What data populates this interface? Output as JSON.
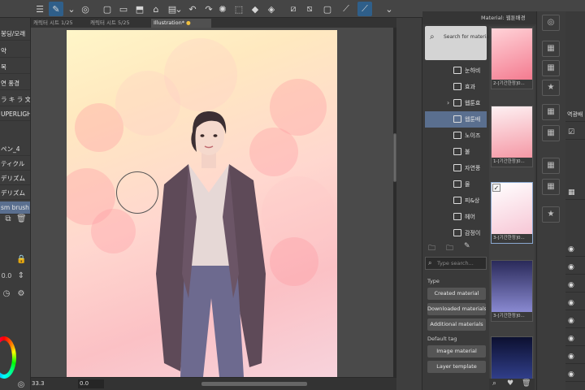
{
  "toolbar": {
    "icons": [
      "menu-icon",
      "pen-tool-icon",
      "chevron-down-icon",
      "layer-settings-icon",
      "clear-icon",
      "new-icon",
      "open-icon",
      "save-icon",
      "print-icon",
      "chevron-down-icon",
      "undo-icon",
      "redo-icon",
      "loading-icon",
      "transform-icon",
      "fill-icon",
      "eraser-icon",
      "selection-icon",
      "snap-icon",
      "ruler-icon",
      "chevron-down-icon"
    ]
  },
  "left_panel": {
    "brushes": [
      {
        "label": "봉딩/모래"
      },
      {
        "label": "약"
      },
      {
        "label": "목"
      },
      {
        "label": "연 풍경"
      },
      {
        "label": "ラ キ ラ 文"
      },
      {
        "label": "UPERLIGH"
      },
      {
        "label": "ペン_4"
      },
      {
        "label": "ティクル"
      },
      {
        "label": "デリズム"
      },
      {
        "label": "デリズム"
      },
      {
        "label": "sm brush"
      }
    ],
    "selected_index": 10,
    "brush_size": "0.0"
  },
  "tabs": [
    {
      "label": "캐릭터 시트",
      "count": "1/25"
    },
    {
      "label": "캐릭터 시트",
      "count": "5/25"
    },
    {
      "label": "Illustration*"
    }
  ],
  "status": {
    "zoom": "33.3",
    "angle": "0.0"
  },
  "material_panel": {
    "title": "Material: 웹툰배경",
    "search_label": "Search for materials",
    "folders": [
      {
        "name": "눈하비"
      },
      {
        "name": "효과"
      },
      {
        "name": "웹툰효"
      },
      {
        "name": "웹툰배"
      },
      {
        "name": "노이즈"
      },
      {
        "name": "불"
      },
      {
        "name": "자연풍"
      },
      {
        "name": "물"
      },
      {
        "name": "피&상"
      },
      {
        "name": "헤어"
      },
      {
        "name": "감정이"
      }
    ],
    "selected_folder": 3,
    "thumbnails": [
      {
        "caption": "2-[기간한정]0..."
      },
      {
        "caption": "1-[기간한정]0..."
      },
      {
        "caption": "3-[기간한정]0..."
      },
      {
        "caption": "3-[기간한정]0..."
      },
      {
        "caption": ""
      }
    ],
    "type_search_placeholder": "Type search...",
    "type_label": "Type",
    "type_buttons": [
      "Created material",
      "Downloaded materials",
      "Additional materials"
    ],
    "default_tag_label": "Default tag",
    "tag_buttons": [
      "Image material",
      "Layer template"
    ]
  },
  "right_panel": {
    "layer_label": "역광배"
  }
}
